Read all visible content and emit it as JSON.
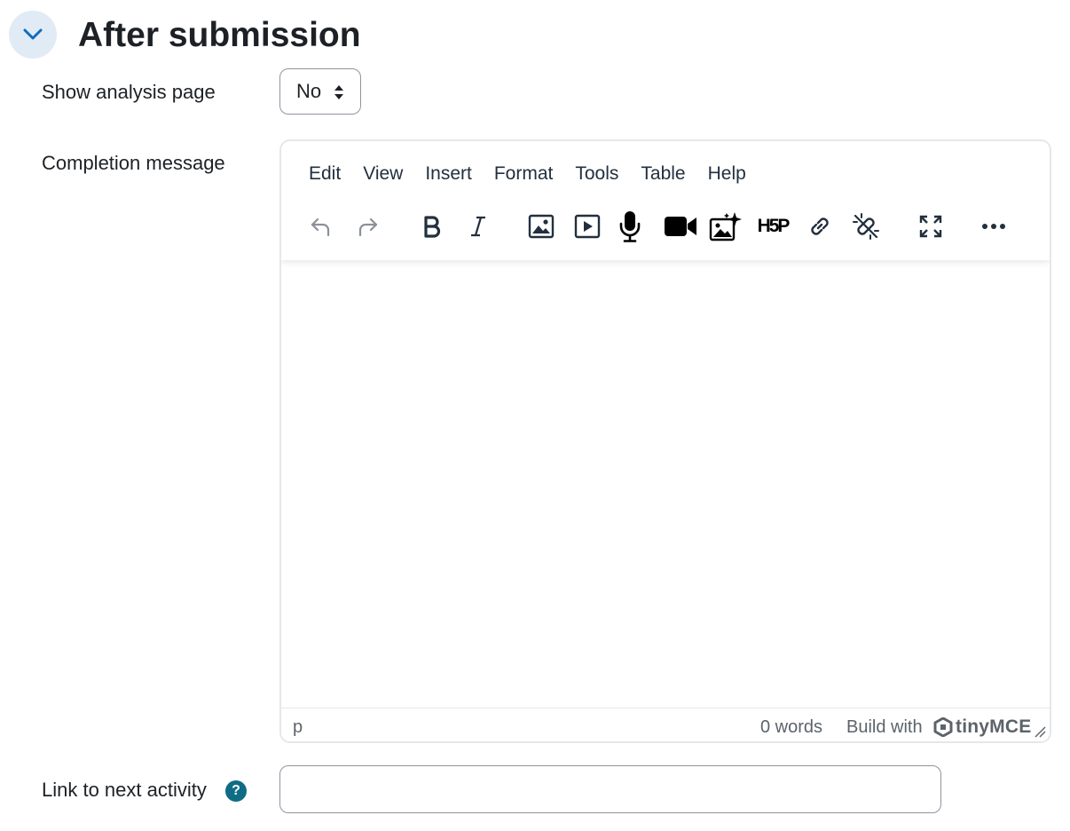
{
  "section": {
    "title": "After submission",
    "toggle_icon": "chevron-down-icon"
  },
  "fields": {
    "show_analysis": {
      "label": "Show analysis page",
      "value": "No"
    },
    "completion_message": {
      "label": "Completion message"
    },
    "next_activity": {
      "label": "Link to next activity",
      "help": "?",
      "value": ""
    }
  },
  "editor": {
    "menu": [
      "Edit",
      "View",
      "Insert",
      "Format",
      "Tools",
      "Table",
      "Help"
    ],
    "toolbar": [
      "undo-icon",
      "redo-icon",
      "bold-icon",
      "italic-icon",
      "image-icon",
      "media-icon",
      "microphone-icon",
      "video-camera-icon",
      "ai-image-icon",
      "h5p-icon",
      "link-icon",
      "unlink-icon",
      "fullscreen-icon",
      "more-icon"
    ],
    "h5p_text": "H5P",
    "status": {
      "path": "p",
      "words": "0 words",
      "build_with": "Build with",
      "brand": "tinyMCE"
    }
  },
  "colors": {
    "toggle_bg": "#e1ebf6",
    "toggle_icon": "#0f6cbf",
    "help_bg": "#0f6c85",
    "text": "#1d2125"
  }
}
